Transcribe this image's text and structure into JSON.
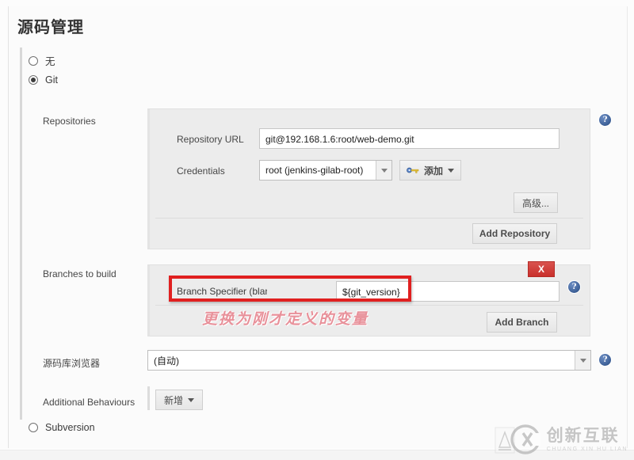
{
  "section": {
    "title": "源码管理"
  },
  "scm_options": [
    {
      "label": "无",
      "selected": false
    },
    {
      "label": "Git",
      "selected": true
    },
    {
      "label": "Subversion",
      "selected": false
    }
  ],
  "repositories": {
    "row_label": "Repositories",
    "url_label": "Repository URL",
    "url_value": "git@192.168.1.6:root/web-demo.git",
    "url_placeholder": "",
    "credentials_label": "Credentials",
    "credentials_value": "root (jenkins-gilab-root)",
    "add_credentials_button": "添加",
    "add_credentials_icon": "key-icon",
    "advanced_button": "高级...",
    "add_repository_button": "Add Repository",
    "help_icon": "help-icon"
  },
  "branches": {
    "row_label": "Branches to build",
    "specifier_label": "Branch Specifier (blank for 'any')",
    "specifier_value": "${git_version}",
    "delete_button": "X",
    "add_branch_button": "Add Branch",
    "help_icon": "help-icon"
  },
  "repo_browser": {
    "row_label": "源码库浏览器",
    "selected": "(自动)",
    "help_icon": "help-icon"
  },
  "additional_behaviours": {
    "row_label": "Additional Behaviours",
    "add_button": "新增"
  },
  "annotation": {
    "text": "更换为刚才定义的变量",
    "box_color": "#e02020",
    "text_color": "#e8919a"
  },
  "watermark": {
    "cn": "创新互联",
    "en": "CHUANG XIN HU LIAN",
    "logo": "cx-circle-logo"
  },
  "colors": {
    "panel_bg": "#ececec",
    "page_bg": "#fcfcfc",
    "help_blue": "#3c5f96",
    "danger_red": "#c9302c"
  }
}
